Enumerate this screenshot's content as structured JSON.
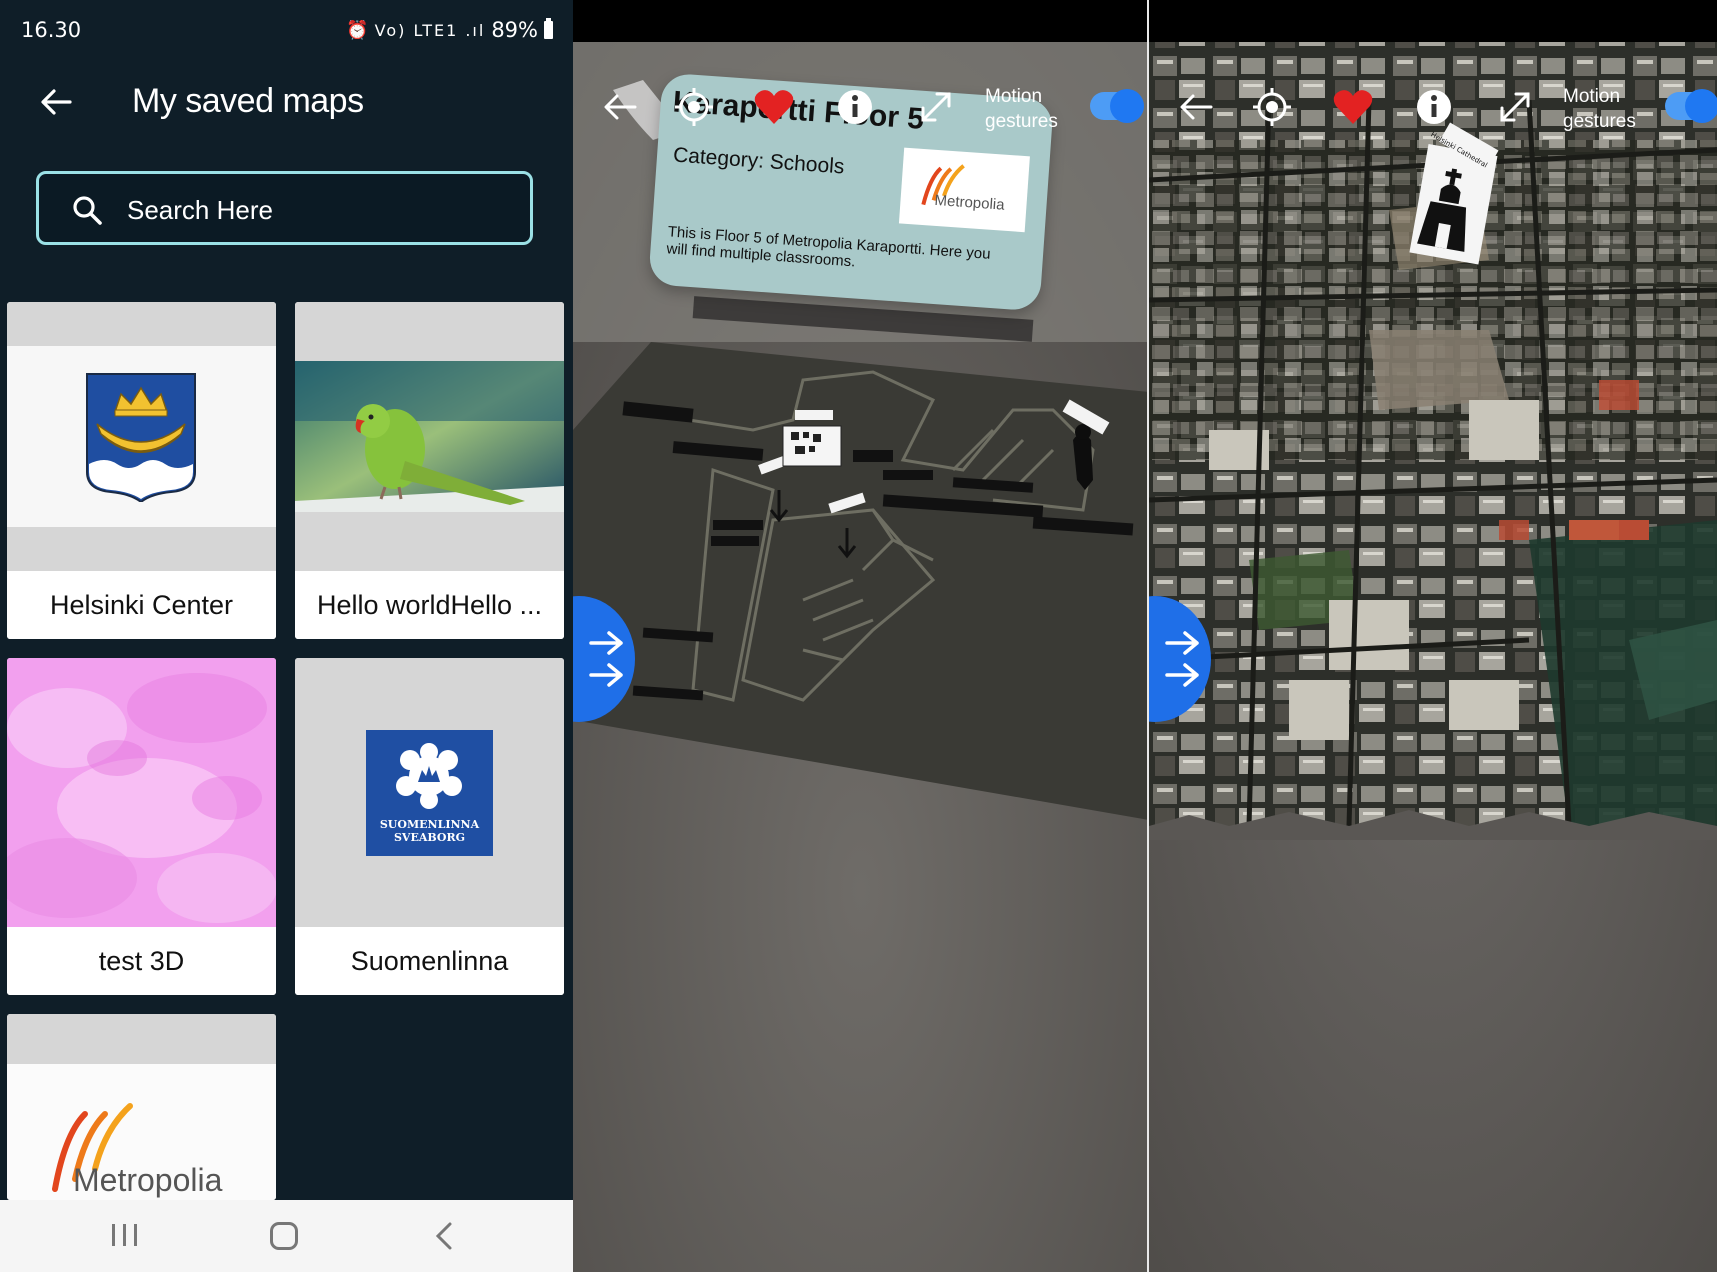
{
  "status_bar": {
    "time": "16.30",
    "indicators": "Vo) LTE1 .ıl",
    "battery": "89%"
  },
  "app_bar": {
    "title": "My saved maps"
  },
  "search": {
    "placeholder": "Search Here"
  },
  "maps": [
    {
      "name": "Helsinki Center",
      "image": "helsinki-coat-of-arms"
    },
    {
      "name": "Hello worldHello ...",
      "image": "parakeet-photo"
    },
    {
      "name": "test 3D",
      "image": "pink-texture"
    },
    {
      "name": "Suomenlinna",
      "image": "suomenlinna-logo",
      "logo_text": [
        "SUOMENLINNA",
        "SVEABORG"
      ]
    },
    {
      "name": "",
      "image": "metropolia-logo",
      "logo_text": "Metropolia"
    }
  ],
  "ar_floor_view": {
    "controls": {
      "motion_label_line1": "Motion",
      "motion_label_line2": "gestures",
      "motion_gestures_on": true
    },
    "info_card": {
      "title": "Karaportti Floor 5",
      "category": "Category: Schools",
      "description_line1": "This is Floor 5 of Metropolia Karaportti. Here you",
      "description_line2": "will find multiple classrooms.",
      "logo_text": "Metropolia"
    }
  },
  "ar_city_view": {
    "controls": {
      "motion_label_line1": "Motion",
      "motion_label_line2": "gestures",
      "motion_gestures_on": true
    },
    "marker_label": "Helsinki Cathedral"
  },
  "colors": {
    "background_dark": "#0f1e28",
    "search_border": "#9be1e6",
    "toggle_blue": "#1f78f2",
    "heart_red": "#e32222",
    "fab_blue": "#1f6fe8",
    "card_mint": "#a9c9c9"
  }
}
